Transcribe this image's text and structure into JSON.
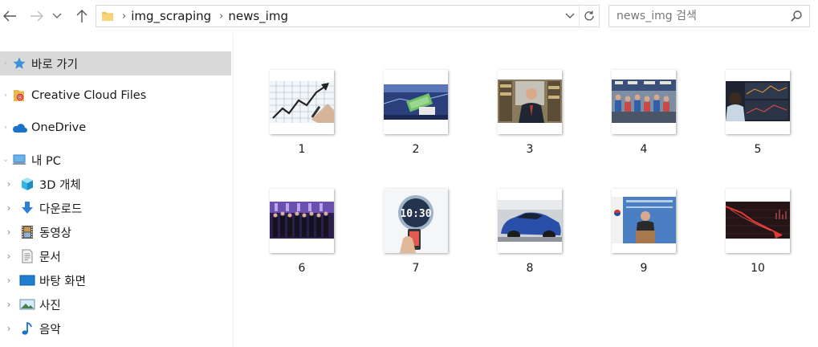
{
  "toolbar": {
    "back_icon": "back-arrow-icon",
    "forward_icon": "forward-arrow-icon",
    "recent_icon": "chevron-down-icon",
    "up_icon": "up-arrow-icon"
  },
  "address": {
    "crumbs": [
      "img_scraping",
      "news_img"
    ]
  },
  "search": {
    "placeholder": "news_img 검색"
  },
  "nav": {
    "items": [
      {
        "label": "바로 가기",
        "icon": "star-icon"
      },
      {
        "label": "Creative Cloud Files",
        "icon": "creative-cloud-icon"
      },
      {
        "label": "OneDrive",
        "icon": "onedrive-cloud-icon"
      },
      {
        "label": "내 PC",
        "icon": "computer-icon"
      },
      {
        "label": "3D 개체",
        "icon": "3d-cube-icon"
      },
      {
        "label": "다운로드",
        "icon": "download-icon"
      },
      {
        "label": "동영상",
        "icon": "video-film-icon"
      },
      {
        "label": "문서",
        "icon": "document-icon"
      },
      {
        "label": "바탕 화면",
        "icon": "desktop-icon"
      },
      {
        "label": "사진",
        "icon": "pictures-icon"
      },
      {
        "label": "음악",
        "icon": "music-note-icon"
      }
    ]
  },
  "files": [
    {
      "name": "1"
    },
    {
      "name": "2"
    },
    {
      "name": "3"
    },
    {
      "name": "4"
    },
    {
      "name": "5"
    },
    {
      "name": "6"
    },
    {
      "name": "7"
    },
    {
      "name": "8"
    },
    {
      "name": "9"
    },
    {
      "name": "10"
    }
  ],
  "thumbnail_text": {
    "clock": "10:30"
  },
  "colors": {
    "selection": "#d9d9d9",
    "folder": "#f2c14e",
    "accent_blue": "#1a73c9"
  }
}
